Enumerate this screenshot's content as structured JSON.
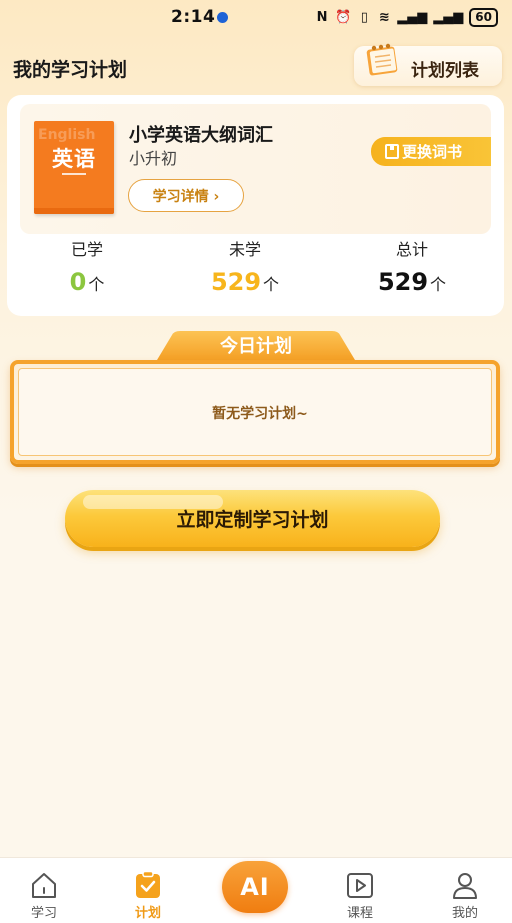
{
  "status_bar": {
    "time": "2:14",
    "battery": "60",
    "icons": [
      "nfc-icon",
      "alarm-icon",
      "vibrate-icon",
      "wifi-icon",
      "signal-4g-icon",
      "signal-4g-icon",
      "battery-icon"
    ]
  },
  "header": {
    "title": "我的学习计划",
    "plan_list_label": "计划列表"
  },
  "book": {
    "cover_text": "英语",
    "cover_ghost_text": "English",
    "title": "小学英语大纲词汇",
    "subtitle": "小升初",
    "detail_button": "学习详情 ›",
    "change_button": "更换词书"
  },
  "stats": {
    "learned_label": "已学",
    "learned_value": "0",
    "unlearned_label": "未学",
    "unlearned_value": "529",
    "total_label": "总计",
    "total_value": "529",
    "unit": "个",
    "colors": {
      "learned": "#8cc63f",
      "unlearned": "#f7b51c",
      "total": "#111111"
    }
  },
  "today_plan": {
    "tab_label": "今日计划",
    "empty_text": "暂无学习计划~"
  },
  "cta": {
    "label": "立即定制学习计划"
  },
  "bottom_nav": {
    "items": [
      {
        "label": "学习",
        "icon": "home-icon"
      },
      {
        "label": "计划",
        "icon": "plan-check-icon",
        "active": true
      },
      {
        "label": "AI",
        "icon": "ai-icon"
      },
      {
        "label": "课程",
        "icon": "play-icon"
      },
      {
        "label": "我的",
        "icon": "profile-icon"
      }
    ]
  },
  "colors": {
    "accent": "#f7b51c",
    "accent_orange": "#f07d10",
    "background": "#fdf7ec"
  }
}
